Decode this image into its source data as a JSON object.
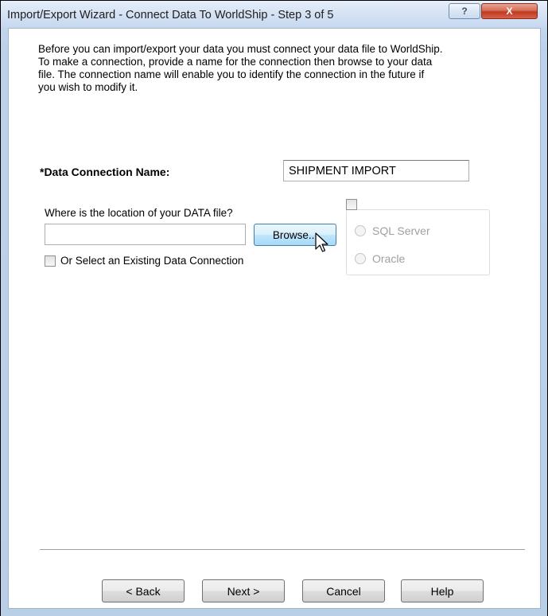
{
  "window": {
    "title": "Import/Export Wizard - Connect Data To WorldShip - Step 3 of 5",
    "help_glyph": "?",
    "close_glyph": "X"
  },
  "intro_text": "Before you can import/export your data you must connect your data file to WorldShip. To make a connection, provide a name for the connection then browse to your data file. The connection name will enable you to identify the connection in the future if you wish to modify it.",
  "connection_name": {
    "label": "*Data Connection Name:",
    "value": "SHIPMENT IMPORT"
  },
  "data_file": {
    "label": "Where is the location of your DATA file?",
    "path_value": "",
    "browse_label": "Browse..."
  },
  "existing_connection": {
    "label": "Or Select an Existing Data Connection",
    "checked": false
  },
  "database": {
    "checked": false,
    "options": [
      {
        "label": "SQL Server",
        "selected": false,
        "enabled": false
      },
      {
        "label": "Oracle",
        "selected": false,
        "enabled": false
      }
    ]
  },
  "buttons": {
    "back": "< Back",
    "next": "Next >",
    "cancel": "Cancel",
    "help": "Help"
  },
  "colors": {
    "frame": "#bdd2ea",
    "browse_hover": "#bee6fd",
    "disabled_text": "#a0a0a0"
  }
}
